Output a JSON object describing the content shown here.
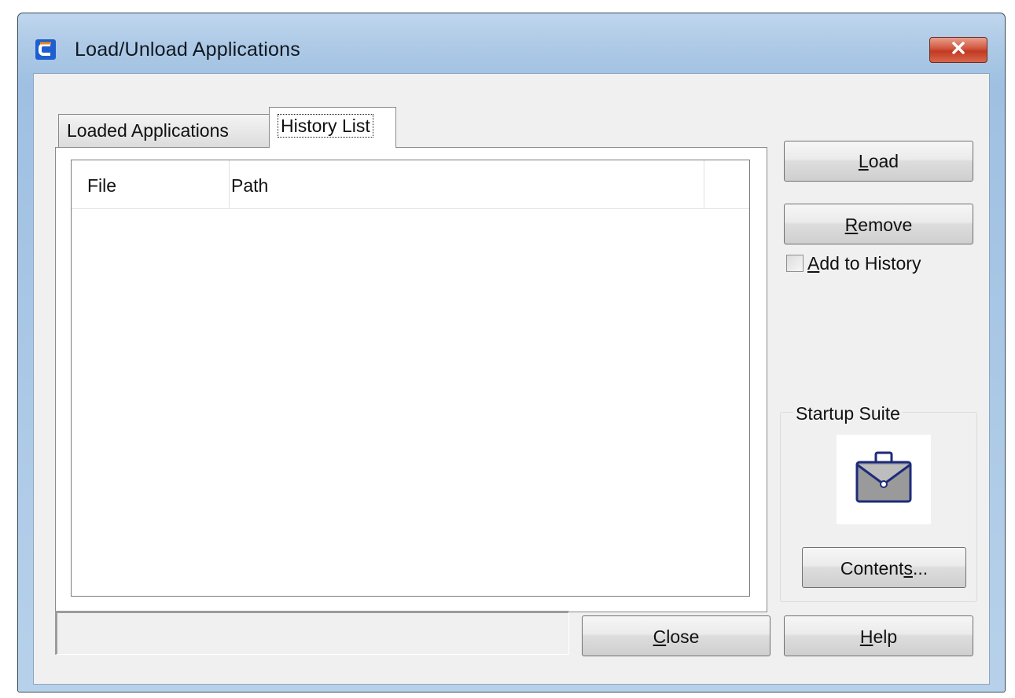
{
  "window": {
    "title": "Load/Unload Applications",
    "accent": "#a9c7e6",
    "close_button_color": "#c7442b"
  },
  "tabs": [
    {
      "label": "Loaded Applications",
      "selected": false
    },
    {
      "label": "History List",
      "selected": true
    }
  ],
  "list": {
    "columns": [
      "File",
      "Path",
      ""
    ],
    "rows": []
  },
  "buttons": {
    "load": {
      "prefix": "",
      "accel": "L",
      "suffix": "oad"
    },
    "remove": {
      "prefix": "",
      "accel": "R",
      "suffix": "emove"
    },
    "contents": {
      "prefix": "Content",
      "accel": "s",
      "suffix": "..."
    },
    "close": {
      "prefix": "",
      "accel": "C",
      "suffix": "lose"
    },
    "help": {
      "prefix": "",
      "accel": "H",
      "suffix": "elp"
    }
  },
  "add_to_history": {
    "accel": "A",
    "rest": "dd to History",
    "checked": false
  },
  "startup_suite": {
    "title": "Startup Suite",
    "icon": "briefcase-icon"
  },
  "icons": {
    "app": "app-logo-icon",
    "close": "close-icon"
  },
  "status": {
    "text": ""
  }
}
